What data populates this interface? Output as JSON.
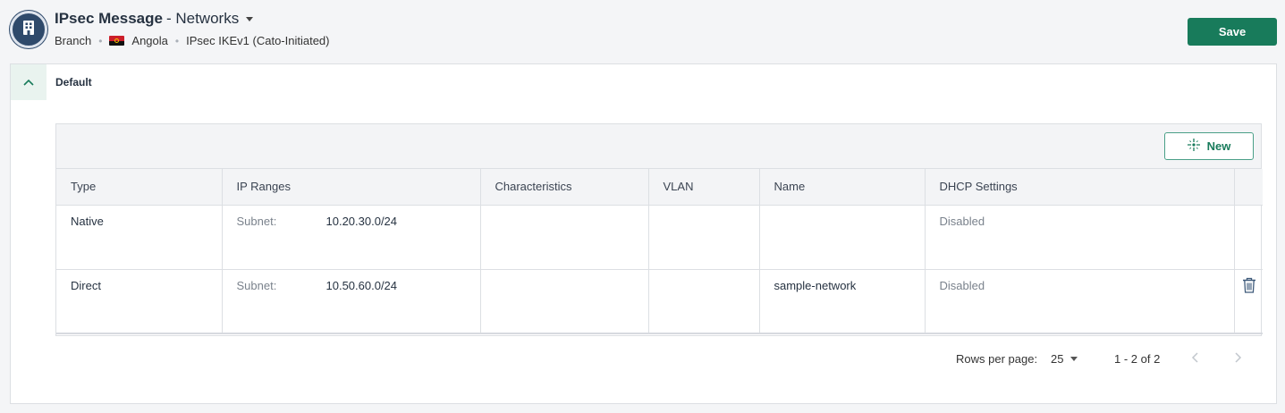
{
  "header": {
    "title": "IPsec Message",
    "subtitle": "- Networks",
    "site_type": "Branch",
    "country": "Angola",
    "connection_type": "IPsec IKEv1 (Cato-Initiated)",
    "save_label": "Save",
    "avatar_icon": "building-icon",
    "flag_icon": "angola-flag-icon"
  },
  "section": {
    "title": "Default",
    "collapse_icon": "chevron-up-icon"
  },
  "table": {
    "new_label": "New",
    "new_icon": "sparkle-icon",
    "columns": [
      "Type",
      "IP Ranges",
      "Characteristics",
      "VLAN",
      "Name",
      "DHCP Settings"
    ],
    "rows": [
      {
        "type": "Native",
        "ip_label": "Subnet:",
        "ip_value": "10.20.30.0/24",
        "characteristics": "",
        "vlan": "",
        "name": "",
        "dhcp": "Disabled"
      },
      {
        "type": "Direct",
        "ip_label": "Subnet:",
        "ip_value": "10.50.60.0/24",
        "characteristics": "",
        "vlan": "",
        "name": "sample-network",
        "dhcp": "Disabled"
      }
    ]
  },
  "pagination": {
    "rows_per_page_label": "Rows per page:",
    "rows_per_page_value": "25",
    "range": "1 - 2 of 2"
  },
  "colors": {
    "primary": "#187b5b",
    "avatar": "#2f4a6b"
  }
}
